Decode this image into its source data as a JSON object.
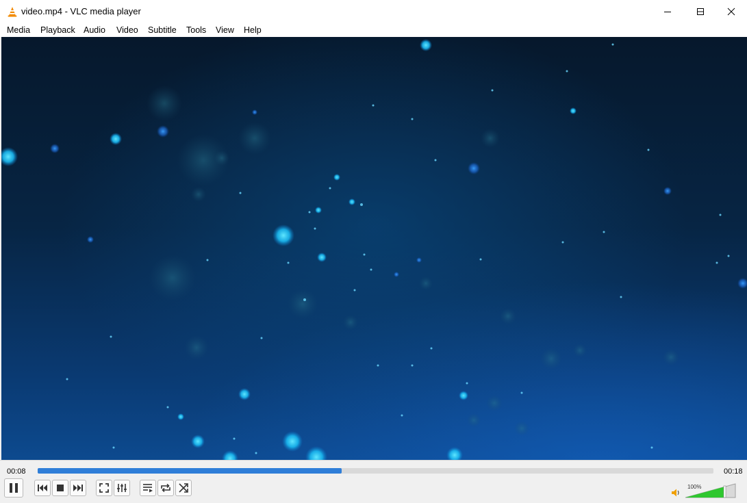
{
  "window": {
    "title": "video.mp4 - VLC media player",
    "icon": "vlc-cone-icon"
  },
  "menu": {
    "items": [
      "Media",
      "Playback",
      "Audio",
      "Video",
      "Subtitle",
      "Tools",
      "View",
      "Help"
    ]
  },
  "player": {
    "elapsed": "00:08",
    "total": "00:18",
    "progress_fraction": 0.45,
    "volume_label": "100%",
    "volume_fraction": 1.0,
    "state": "playing"
  },
  "controls": {
    "icons": [
      "pause-icon",
      "previous-icon",
      "stop-icon",
      "next-icon",
      "fullscreen-icon",
      "extended-settings-icon",
      "playlist-icon",
      "loop-icon",
      "shuffle-icon",
      "speaker-icon"
    ]
  },
  "colors": {
    "accent": "#2f7ed8",
    "volume_green": "#2fc72f"
  }
}
